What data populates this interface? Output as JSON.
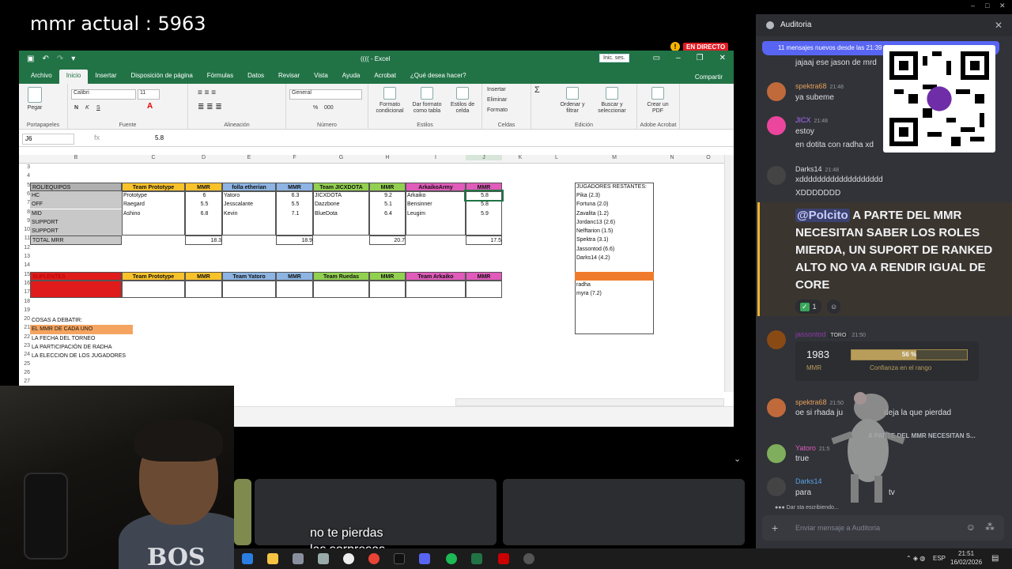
{
  "overlay": {
    "mmr_text": "mmr actual : 5963",
    "live_badge": "EN DIRECTO",
    "caption_line1": "no te pierdas",
    "caption_line2": "las sorpresas"
  },
  "colors": {
    "excel_green": "#217346",
    "discord_bg": "#313338",
    "discord_accent": "#5865f2",
    "live_red": "#e01b24"
  },
  "excel": {
    "title": "(((( - Excel",
    "sign_in": "Inic. ses.",
    "tabs": [
      "Archivo",
      "Inicio",
      "Insertar",
      "Disposición de página",
      "Fórmulas",
      "Datos",
      "Revisar",
      "Vista",
      "Ayuda",
      "Acrobat",
      "¿Qué desea hacer?"
    ],
    "share": "Compartir",
    "ribbon": {
      "paste": "Pegar",
      "clipboard": "Portapapeles",
      "font_name": "Calibri",
      "font_size": "11",
      "font_group": "Fuente",
      "bold": "N",
      "italic": "K",
      "underline": "S",
      "alignment": "Alineación",
      "number_format": "General",
      "number_group": "Número",
      "percent": "%",
      "thousands": "000",
      "cond_format": "Formato condicional",
      "format_table": "Dar formato como tabla",
      "cell_styles": "Estilos de celda",
      "styles_group": "Estilos",
      "insert": "Insertar",
      "delete": "Eliminar",
      "format": "Formato",
      "cells_group": "Celdas",
      "sort": "Ordenar y filtrar",
      "find": "Buscar y seleccionar",
      "editing_group": "Edición",
      "create_pdf": "Crear un PDF",
      "adobe_group": "Adobe Acrobat"
    },
    "name_box": "J6",
    "fx": "fx",
    "formula_value": "5.8",
    "columns": [
      "B",
      "C",
      "D",
      "E",
      "F",
      "G",
      "H",
      "I",
      "J",
      "K",
      "L",
      "M",
      "N",
      "O"
    ],
    "rows": [
      "3",
      "4",
      "5",
      "6",
      "7",
      "8",
      "9",
      "10",
      "11",
      "12",
      "13",
      "14",
      "15",
      "16",
      "17",
      "18",
      "19",
      "20",
      "21",
      "22",
      "23",
      "24",
      "25",
      "26",
      "27"
    ],
    "table1": {
      "header": [
        "ROL/EQUIPOS",
        "Team Prototype",
        "MMR",
        "folla etherian",
        "MMR",
        "Team JICXDOTA",
        "MMR",
        "ArkaikoArmy",
        "MMR"
      ],
      "roles": [
        "HC",
        "OFF",
        "MID",
        "SUPPORT",
        "SUPPORT"
      ],
      "team1_players": [
        "Prototype",
        "Raegard",
        "Ashino"
      ],
      "team1_mmr": [
        "6",
        "5.5",
        "6.8"
      ],
      "team2_players": [
        "Yatoro",
        "Jesscalante",
        "Kevin"
      ],
      "team2_mmr": [
        "6.3",
        "5.5",
        "7.1"
      ],
      "team3_players": [
        "JICXDOTA",
        "Dazzbone",
        "BlueDota"
      ],
      "team3_mmr": [
        "9.2",
        "5.1",
        "6.4"
      ],
      "team4_players": [
        "Arkaiko",
        "Bensinner",
        "Leugim"
      ],
      "team4_mmr": [
        "5.8",
        "5.8",
        "5.9"
      ],
      "total_label": "TOTAL MRR",
      "totals": [
        "18.3",
        "18.9",
        "20.7",
        "17.5"
      ]
    },
    "table2": {
      "header": [
        "SUPLENTES",
        "Team Prototype",
        "MMR",
        "Team Yatoro",
        "MMR",
        "Team Ruedas",
        "MMR",
        "Team Arkaiko",
        "MMR"
      ]
    },
    "debate": [
      "COSAS A DEBATIR:",
      "EL MMR DE CADA UNO",
      "LA FECHA DEL TORNEO",
      "LA PARTICIPACIÓN DE RADHA",
      "LA ELECCION DE LOS JUGADORES"
    ],
    "remaining": {
      "title": "JUGADORES RESTANTES:",
      "players": [
        "Pika (2.3)",
        "Fortuna (2.0)",
        "Zavalita (1.2)",
        "Jordanc13 (2.6)",
        "Nelftarion (1.5)",
        "Spektra (3.1)",
        "Jassontod (6.6)",
        "Darks14 (4.2)"
      ],
      "extra": [
        "radha",
        "myra (7.2)"
      ]
    }
  },
  "chat": {
    "title": "Auditoria",
    "new_messages": "11 mensajes nuevos desde las 21:39",
    "messages": [
      {
        "text": "jajaaj  ese jason de mrd"
      },
      {
        "user": "spektra68",
        "time": "21:48",
        "text": "ya subeme",
        "color": "#e6a05a"
      },
      {
        "user": "JICX",
        "time": "21:48",
        "text": "estoy",
        "text2": "en dotita con radha xd",
        "color": "#ad6bff"
      },
      {
        "user": "Darks14",
        "time": "21:48",
        "text": "xddddddddddddddddddd",
        "text2": "XDDDDDDD",
        "color": "#dbdee1"
      },
      {
        "mention": "@Polcito",
        "text": "A PARTE DEL MMR NECESITAN SABER LOS ROLES MIERDA, UN SUPORT DE RANKED ALTO NO VA A RENDIR IGUAL DE CORE",
        "reaction_count": "1"
      },
      {
        "user": "jassontod",
        "tag": "TORO",
        "time": "21:50",
        "color": "#8e3aa8"
      },
      {
        "user": "spektra68",
        "time": "21:50",
        "text": "oe si rhada ju",
        "text2": "deja la que pierdad",
        "color": "#e6a05a"
      },
      {
        "reply": "A PARTE DEL MMR NECESITAN S..."
      },
      {
        "user": "Yatoro",
        "time": "21:5",
        "text": "true",
        "color": "#e05bba"
      },
      {
        "user": "Darks14",
        "text": "para",
        "text2": "tv",
        "color": "#5aa1e6"
      }
    ],
    "embed": {
      "mmr_value": "1983",
      "mmr_label": "MMR",
      "confidence": 0.56,
      "confidence_text": "56 %",
      "confidence_label": "Confianza en el rango"
    },
    "typing": "Dar    sta escribiendo...",
    "input_placeholder": "Enviar mensaje a Auditoria"
  },
  "taskbar": {
    "lang": "ESP",
    "time": "21:51",
    "date": "16/02/2026"
  }
}
